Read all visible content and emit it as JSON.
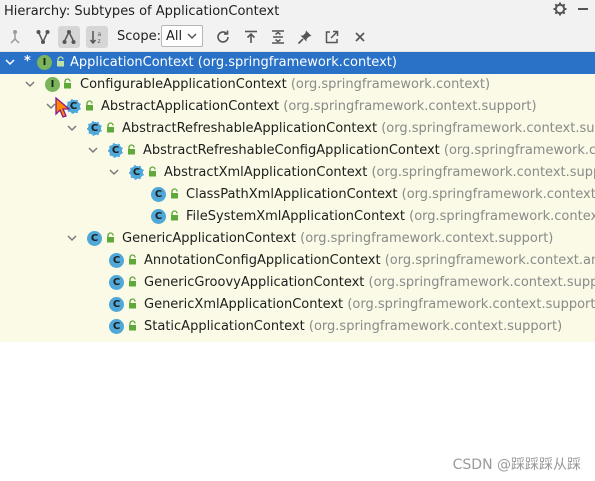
{
  "window": {
    "title": "Hierarchy:  Subtypes of ApplicationContext"
  },
  "titlebar_icons": [
    "gear-icon",
    "minimize-icon"
  ],
  "toolbar": {
    "tools": [
      {
        "name": "supertypes-hierarchy-button",
        "icon": "supertypes-icon",
        "active": false
      },
      {
        "name": "class-hierarchy-button",
        "icon": "class-hierarchy-icon",
        "active": false
      },
      {
        "name": "subtypes-hierarchy-button",
        "icon": "subtypes-icon",
        "active": true
      },
      {
        "name": "sort-alphabetically-button",
        "icon": "sort-az-icon",
        "active": true
      }
    ],
    "scope_label": "Scope:",
    "scope_value": "All",
    "actions": [
      "refresh-icon",
      "export-icon",
      "expand-all-icon",
      "pin-icon",
      "open-in-editor-icon",
      "close-icon"
    ]
  },
  "tree": [
    {
      "name": "ApplicationContext",
      "pkg": "(org.springframework.context)",
      "kind": "interface",
      "selected": true,
      "star": true
    },
    {
      "name": "ConfigurableApplicationContext",
      "pkg": "(org.springframework.context)",
      "kind": "interface"
    },
    {
      "name": "AbstractApplicationContext",
      "pkg": "(org.springframework.context.support)",
      "kind": "abstract"
    },
    {
      "name": "AbstractRefreshableApplicationContext",
      "pkg": "(org.springframework.context.support)",
      "kind": "abstract"
    },
    {
      "name": "AbstractRefreshableConfigApplicationContext",
      "pkg": "(org.springframework.conte",
      "kind": "abstract"
    },
    {
      "name": "AbstractXmlApplicationContext",
      "pkg": "(org.springframework.context.support)",
      "kind": "abstract"
    },
    {
      "name": "ClassPathXmlApplicationContext",
      "pkg": "(org.springframework.context.sup",
      "kind": "class"
    },
    {
      "name": "FileSystemXmlApplicationContext",
      "pkg": "(org.springframework.context.sup",
      "kind": "class"
    },
    {
      "name": "GenericApplicationContext",
      "pkg": "(org.springframework.context.support)",
      "kind": "class"
    },
    {
      "name": "AnnotationConfigApplicationContext",
      "pkg": "(org.springframework.context.annota",
      "kind": "class"
    },
    {
      "name": "GenericGroovyApplicationContext",
      "pkg": "(org.springframework.context.support)",
      "kind": "class"
    },
    {
      "name": "GenericXmlApplicationContext",
      "pkg": "(org.springframework.context.support)",
      "kind": "class"
    },
    {
      "name": "StaticApplicationContext",
      "pkg": "(org.springframework.context.support)",
      "kind": "class"
    }
  ],
  "watermark": "CSDN @踩踩踩从踩"
}
